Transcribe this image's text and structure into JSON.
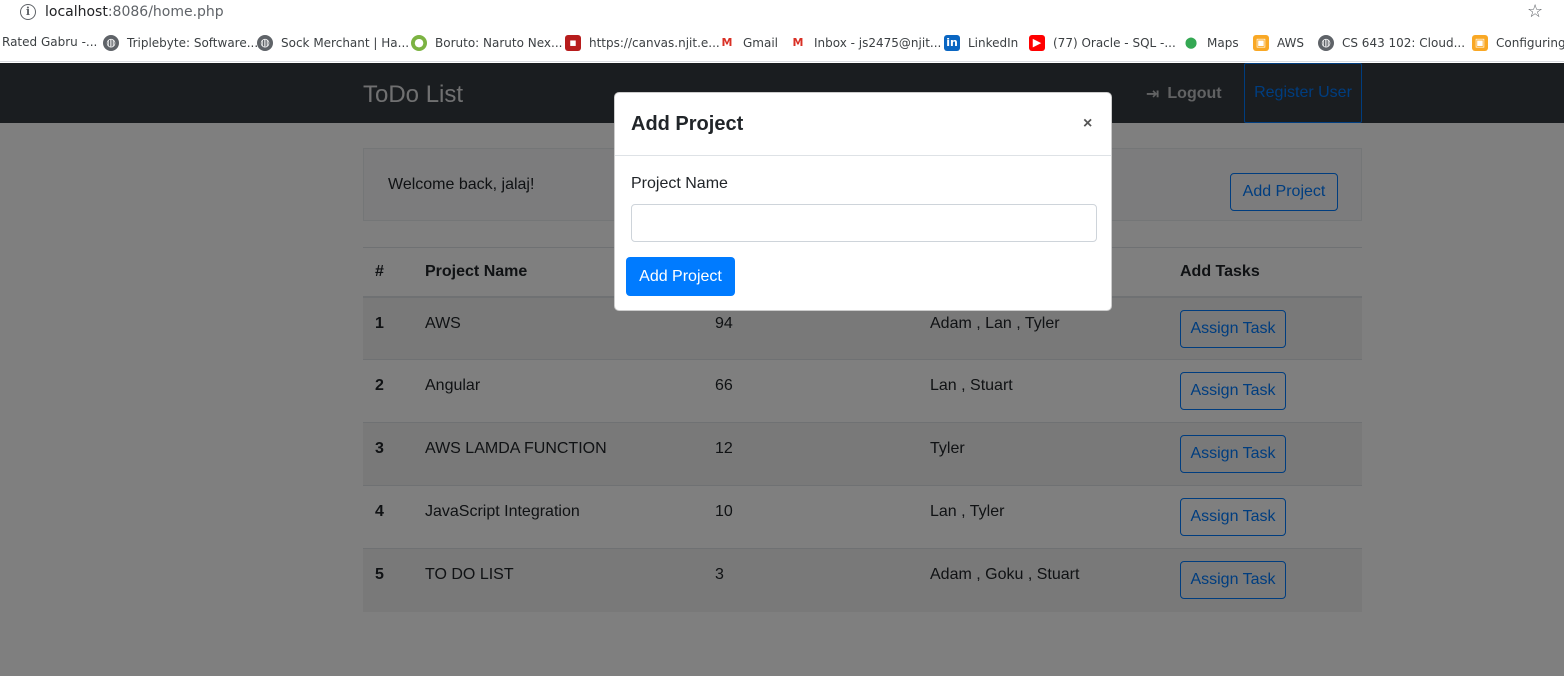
{
  "browser": {
    "url_host": "localhost",
    "url_path": ":8086/home.php",
    "bookmarks": [
      {
        "label": "Rated Gabru -...",
        "icon": "none"
      },
      {
        "label": "Triplebyte: Software...",
        "icon": "globe-icon"
      },
      {
        "label": "Sock Merchant | Ha...",
        "icon": "globe-icon"
      },
      {
        "label": "Boruto: Naruto Nex...",
        "icon": "boruto-icon"
      },
      {
        "label": "https://canvas.njit.e...",
        "icon": "canvas-icon"
      },
      {
        "label": "Gmail",
        "icon": "gmail-icon"
      },
      {
        "label": "Inbox - js2475@njit...",
        "icon": "gmail-icon"
      },
      {
        "label": "LinkedIn",
        "icon": "linkedin-icon"
      },
      {
        "label": "(77) Oracle - SQL -...",
        "icon": "youtube-icon"
      },
      {
        "label": "Maps",
        "icon": "maps-icon"
      },
      {
        "label": "AWS",
        "icon": "aws-icon"
      },
      {
        "label": "CS 643 102: Cloud...",
        "icon": "globe-icon"
      },
      {
        "label": "Configuring a",
        "icon": "aws-icon"
      }
    ]
  },
  "navbar": {
    "brand": "ToDo List",
    "logout_label": "Logout",
    "register_label": "Register User"
  },
  "welcome": {
    "text": "Welcome back, jalaj!",
    "add_project_label": "Add Project"
  },
  "table": {
    "headers": [
      "#",
      "Project Name",
      "",
      "",
      "Add Tasks"
    ],
    "rows": [
      {
        "num": "1",
        "name": "AWS",
        "value": "94",
        "members": "Adam , Lan , Tyler",
        "action": "Assign Task"
      },
      {
        "num": "2",
        "name": "Angular",
        "value": "66",
        "members": "Lan , Stuart",
        "action": "Assign Task"
      },
      {
        "num": "3",
        "name": "AWS LAMDA FUNCTION",
        "value": "12",
        "members": "Tyler",
        "action": "Assign Task"
      },
      {
        "num": "4",
        "name": "JavaScript Integration",
        "value": "10",
        "members": "Lan , Tyler",
        "action": "Assign Task"
      },
      {
        "num": "5",
        "name": "TO DO LIST",
        "value": "3",
        "members": "Adam , Goku , Stuart",
        "action": "Assign Task"
      }
    ]
  },
  "modal": {
    "title": "Add Project",
    "close_glyph": "×",
    "field_label": "Project Name",
    "field_value": "",
    "submit_label": "Add Project"
  },
  "colors": {
    "primary": "#007bff",
    "navbar": "#343a40"
  }
}
